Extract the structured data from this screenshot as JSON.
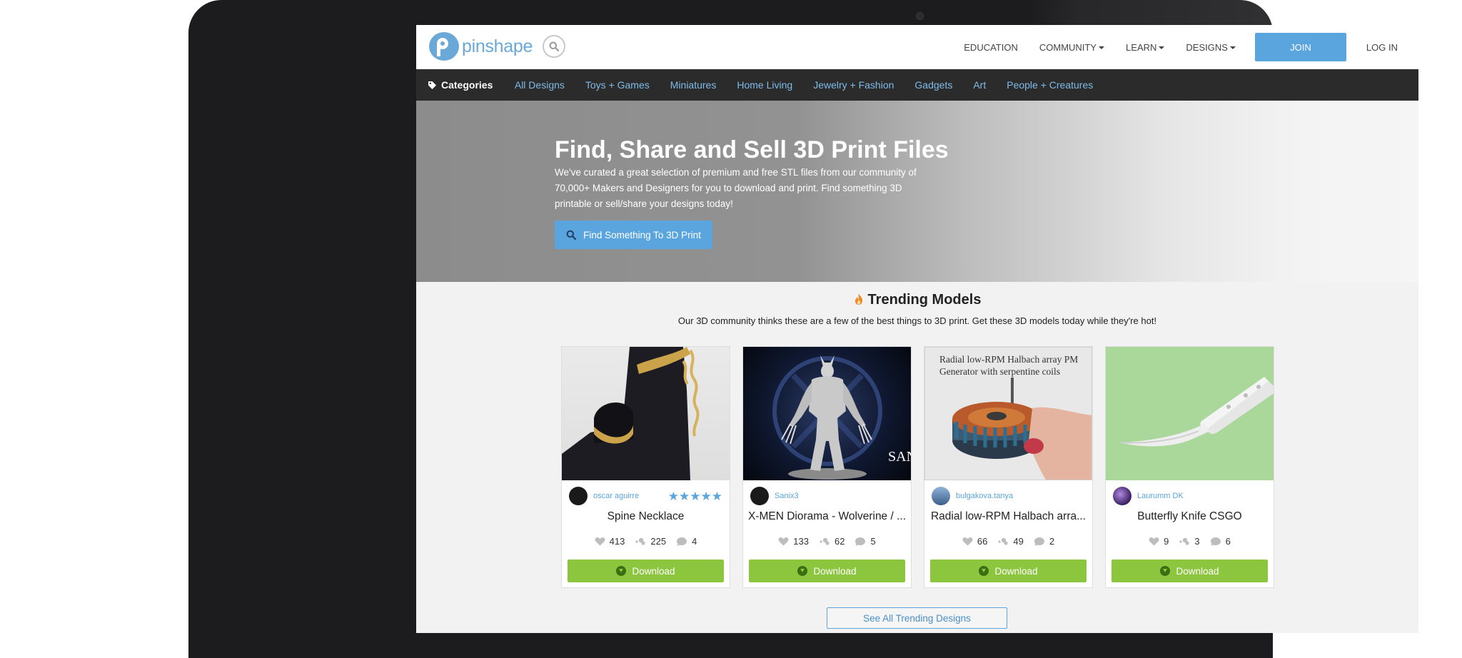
{
  "brand": {
    "name": "pinshape",
    "accent": "#5aa5de",
    "download_color": "#8cc63e"
  },
  "topnav": {
    "links": [
      {
        "label": "EDUCATION",
        "dropdown": false
      },
      {
        "label": "COMMUNITY",
        "dropdown": true
      },
      {
        "label": "LEARN",
        "dropdown": true
      },
      {
        "label": "DESIGNS",
        "dropdown": true
      }
    ],
    "join": "JOIN",
    "login": "LOG IN"
  },
  "categories": {
    "label": "Categories",
    "items": [
      "All Designs",
      "Toys + Games",
      "Miniatures",
      "Home Living",
      "Jewelry + Fashion",
      "Gadgets",
      "Art",
      "People + Creatures"
    ]
  },
  "hero": {
    "title": "Find, Share and Sell 3D Print Files",
    "description": "We've curated a great selection of premium and free STL files from our community of 70,000+ Makers and Designers for you to download and print. Find something 3D printable or sell/share your designs today!",
    "button": "Find Something To 3D Print"
  },
  "trending": {
    "title": "Trending Models",
    "subtitle": "Our 3D community thinks these are a few of the best things to 3D print. Get these 3D models today while they're hot!",
    "see_all": "See All Trending Designs",
    "download_label": "Download",
    "cards": [
      {
        "author": "oscar aguirre",
        "title": "Spine Necklace",
        "likes": "413",
        "downloads": "225",
        "comments": "4",
        "rating": 5,
        "image_text": ""
      },
      {
        "author": "Sanix3",
        "title": "X-MEN Diorama - Wolverine / ...",
        "likes": "133",
        "downloads": "62",
        "comments": "5",
        "rating": 0,
        "image_text": "SAN"
      },
      {
        "author": "bulgakova.tanya",
        "title": "Radial low-RPM Halbach arra...",
        "likes": "66",
        "downloads": "49",
        "comments": "2",
        "rating": 0,
        "image_text": "Radial low-RPM Halbach array PM Generator with serpentine coils"
      },
      {
        "author": "Laurumm DK",
        "title": "Butterfly Knife CSGO",
        "likes": "9",
        "downloads": "3",
        "comments": "6",
        "rating": 0,
        "image_text": ""
      }
    ]
  }
}
